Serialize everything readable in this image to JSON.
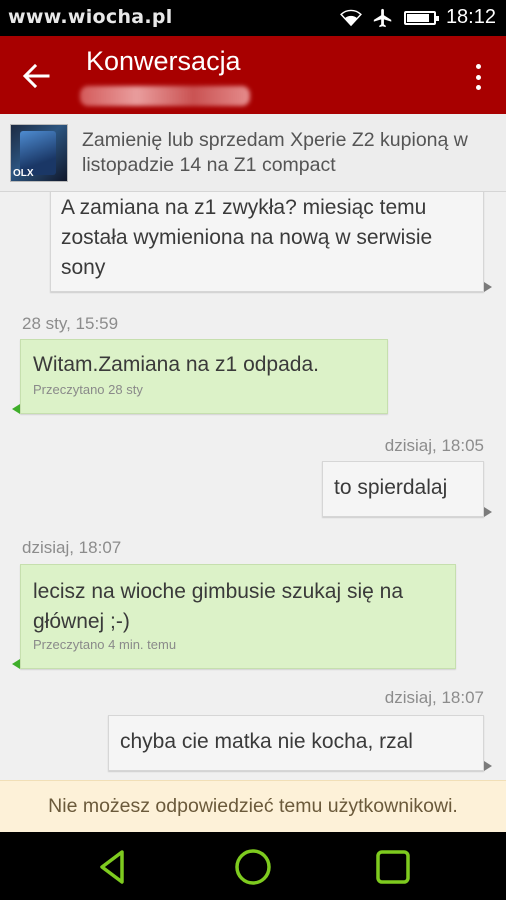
{
  "status_bar": {
    "watermark": "www.wiocha.pl",
    "time": "18:12",
    "icons": [
      "wifi-icon",
      "airplane-mode-icon",
      "battery-icon"
    ],
    "battery_level": 0.85
  },
  "app_bar": {
    "title": "Konwersacja",
    "back_icon": "arrow-left-icon",
    "menu_icon": "more-vertical-icon",
    "background": "#a80000"
  },
  "listing": {
    "title": "Zamienię lub sprzedam Xperie Z2 kupioną w listopadzie 14 na Z1 compact",
    "thumb_label": "OLX"
  },
  "messages": {
    "m1": {
      "side": "right",
      "text": "A zamiana na z1 zwykła?  miesiąc temu została wymieniona na nową w serwisie sony"
    },
    "m2": {
      "side": "left",
      "timestamp": "28  sty, 15:59",
      "text": "Witam.Zamiana na z1 odpada.",
      "read": "Przeczytano 28  sty"
    },
    "m3": {
      "side": "right",
      "timestamp": "dzisiaj, 18:05",
      "text": "to spierdalaj"
    },
    "m4": {
      "side": "left",
      "timestamp": "dzisiaj, 18:07",
      "text": "lecisz na wioche gimbusie szukaj się na głównej ;-)",
      "read": "Przeczytano 4 min. temu"
    },
    "m5": {
      "side": "right",
      "timestamp": "dzisiaj, 18:07",
      "text": "chyba cie matka nie kocha, rzal"
    }
  },
  "notice": {
    "text": "Nie możesz odpowiedzieć temu użytkownikowi.",
    "background": "#fdf1d8"
  },
  "nav_bar": {
    "buttons": [
      "back-triangle-icon",
      "home-circle-icon",
      "recents-square-icon"
    ],
    "color": "#7ecb1f"
  },
  "colors": {
    "sent_bubble": "#f5f5f5",
    "received_bubble": "#dcf2c8"
  }
}
